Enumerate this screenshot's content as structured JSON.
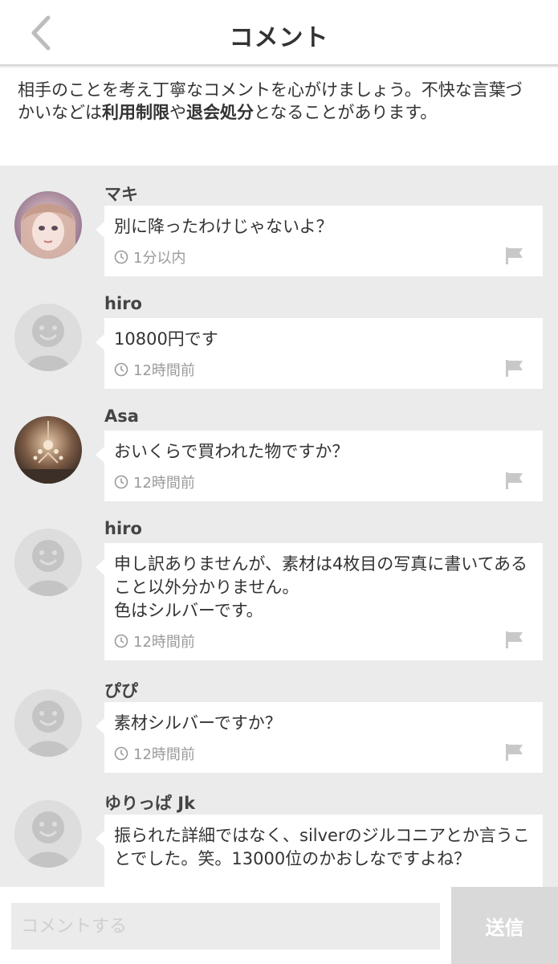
{
  "header": {
    "title": "コメント",
    "back_icon": "chevron-left-icon"
  },
  "notice": {
    "text_1": "相手のことを考え丁寧なコメントを心がけましょう。不快な言葉づかいなどは",
    "bold_1": "利用制限",
    "text_2": "や",
    "bold_2": "退会処分",
    "text_3": "となることがあります。"
  },
  "comments": [
    {
      "user": "マキ",
      "avatar": "photo",
      "text": "別に降ったわけじゃないよ？",
      "time": "1分以内"
    },
    {
      "user": "hiro",
      "avatar": "default",
      "text": "10800円です",
      "time": "12時間前"
    },
    {
      "user": "Asa",
      "avatar": "photo",
      "text": "おいくらで買われた物ですか？",
      "time": "12時間前"
    },
    {
      "user": "hiro",
      "avatar": "default",
      "text": "申し訳ありませんが、素材は4枚目の写真に書いてあること以外分かりません。\n色はシルバーです。",
      "time": "12時間前"
    },
    {
      "user": "ぴぴ",
      "avatar": "default",
      "text": "素材シルバーですか？",
      "time": "12時間前"
    },
    {
      "user": "ゆりっぱ Jk",
      "avatar": "default",
      "text": "振られた詳細ではなく、silverのジルコニアとか言うことでした。笑。13000位のかおしなですよね？",
      "time": ""
    }
  ],
  "input": {
    "placeholder": "コメントする",
    "send_label": "送信"
  },
  "colors": {
    "background": "#ebebeb",
    "bubble": "#ffffff",
    "meta": "#9a9a9a",
    "send_button": "#d9d9d9"
  }
}
